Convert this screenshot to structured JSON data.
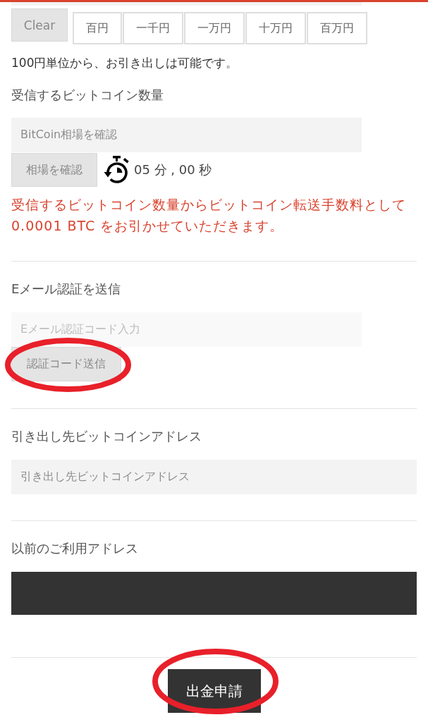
{
  "amount_buttons": [
    {
      "label": "Clear",
      "kind": "clear"
    },
    {
      "label": "百円",
      "kind": "unit"
    },
    {
      "label": "一千円",
      "kind": "unit"
    },
    {
      "label": "一万円",
      "kind": "unit"
    },
    {
      "label": "十万円",
      "kind": "unit"
    },
    {
      "label": "百万円",
      "kind": "unit"
    }
  ],
  "unit_note": "100円単位から、お引き出しは可能です。",
  "bitcoin_amount": {
    "heading": "受信するビットコイン数量",
    "rate_field": {
      "placeholder": "BitCoin相場を確認"
    },
    "rate_button": {
      "label": "相場を確認"
    },
    "timer": "05 分 , 00 秒",
    "fee_notice": "受信するビットコイン数量からビットコイン転送手数料として 0.0001 BTC をお引かせていただきます。"
  },
  "email_verification": {
    "heading": "Eメール認証を送信",
    "code_field": {
      "placeholder": "Eメール認証コード入力",
      "disabled": true
    },
    "send_button": {
      "label": "認証コード送信",
      "circled": true
    }
  },
  "withdrawal_address": {
    "heading": "引き出し先ビットコインアドレス",
    "address_field": {
      "placeholder": "引き出し先ビットコインアドレス"
    }
  },
  "previous_addresses": {
    "heading": "以前のご利用アドレス"
  },
  "submit_button": {
    "label": "出金申請",
    "circled": true
  }
}
